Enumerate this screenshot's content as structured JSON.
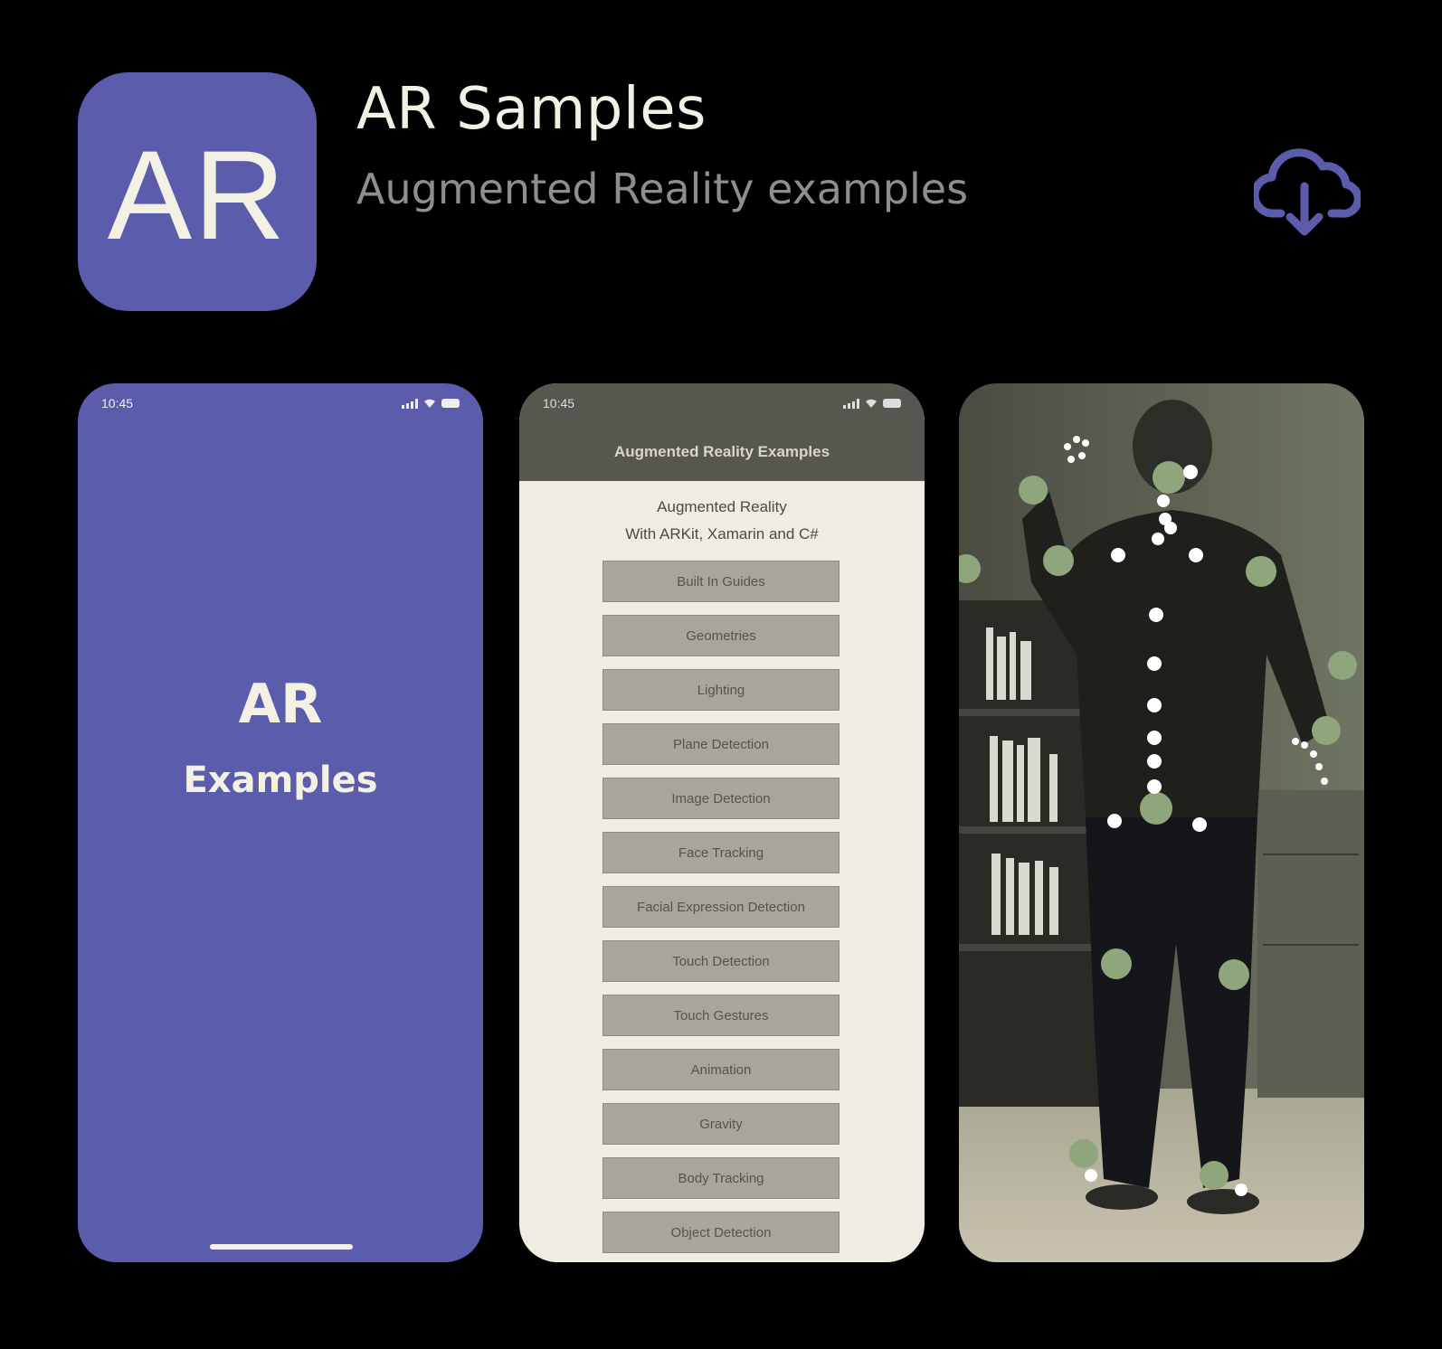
{
  "app": {
    "icon_text": "AR",
    "title": "AR Samples",
    "subtitle": "Augmented Reality examples",
    "download_icon": "cloud-download-icon",
    "accent_color": "#5c5cad"
  },
  "screens": {
    "splash": {
      "time": "10:45",
      "title": "AR",
      "subtitle": "Examples",
      "background": "#5c5cad"
    },
    "menu": {
      "time": "10:45",
      "nav_title": "Augmented Reality Examples",
      "intro_line1": "Augmented Reality",
      "intro_line2": "With ARKit, Xamarin and C#",
      "items": [
        "Built In Guides",
        "Geometries",
        "Lighting",
        "Plane Detection",
        "Image Detection",
        "Face Tracking",
        "Facial Expression Detection",
        "Touch Detection",
        "Touch Gestures",
        "Animation",
        "Gravity",
        "Body Tracking",
        "Object Detection"
      ]
    },
    "body_tracking": {
      "joint_color": "#8fa57c"
    }
  }
}
